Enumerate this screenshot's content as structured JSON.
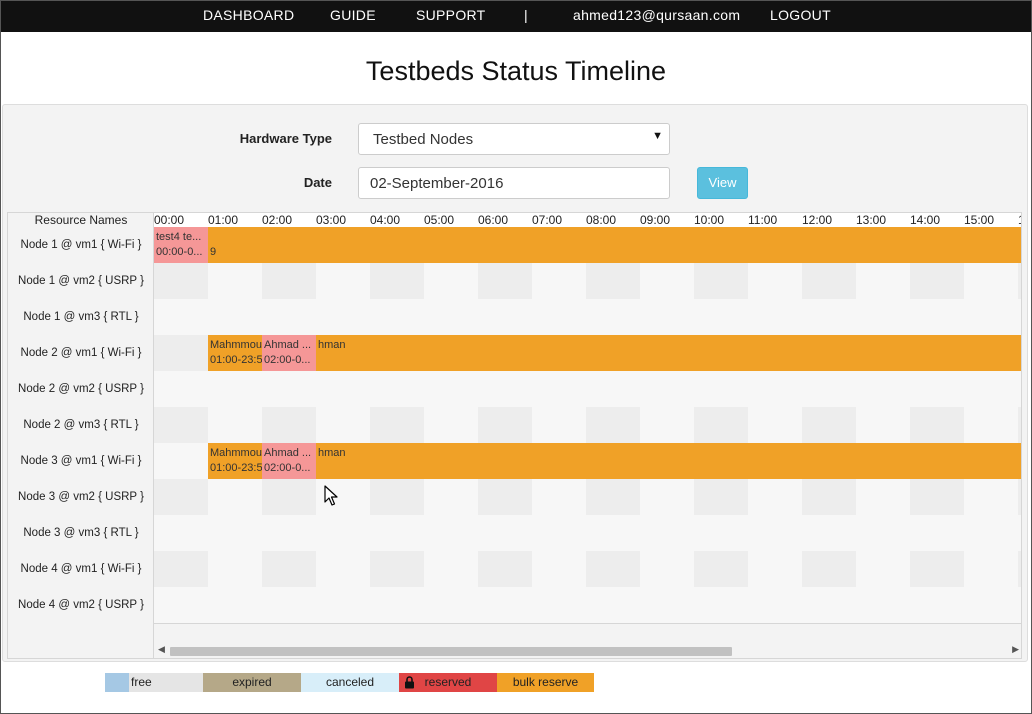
{
  "nav": {
    "dashboard": "DASHBOARD",
    "guide": "GUIDE",
    "support": "SUPPORT",
    "separator": "|",
    "user_email": "ahmed123@qursaan.com",
    "logout": "LOGOUT"
  },
  "page_title": "Testbeds Status Timeline",
  "form": {
    "hardware_label": "Hardware Type",
    "hardware_value": "Testbed Nodes",
    "date_label": "Date",
    "date_value": "02-September-2016",
    "view_button": "View"
  },
  "scheduler": {
    "resource_header": "Resource Names",
    "time_slots": [
      "00:00",
      "01:00",
      "02:00",
      "03:00",
      "04:00",
      "05:00",
      "06:00",
      "07:00",
      "08:00",
      "09:00",
      "10:00",
      "11:00",
      "12:00",
      "13:00",
      "14:00",
      "15:00",
      "1"
    ],
    "resources": [
      "Node 1 @ vm1 { Wi-Fi }",
      "Node 1 @ vm2 { USRP }",
      "Node 1 @ vm3 { RTL }",
      "Node 2 @ vm1 { Wi-Fi }",
      "Node 2 @ vm2 { USRP }",
      "Node 2 @ vm3 { RTL }",
      "Node 3 @ vm1 { Wi-Fi }",
      "Node 3 @ vm2 { USRP }",
      "Node 3 @ vm3 { RTL }",
      "Node 4 @ vm1 { Wi-Fi }",
      "Node 4 @ vm2 { USRP }"
    ],
    "events": {
      "n1_reserved_title": "test4 te...",
      "n1_reserved_time": "00:00-0...",
      "n1_bulk_time": "9",
      "n2_bulk_a_title": "Mahmmou",
      "n2_bulk_a_time": "01:00-23:5",
      "n2_res_title": "Ahmad ...",
      "n2_res_time": "02:00-0...",
      "n2_bulk_b_title": "hman",
      "n3_bulk_a_title": "Mahmmou",
      "n3_bulk_a_time": "01:00-23:5",
      "n3_res_title": "Ahmad ...",
      "n3_res_time": "02:00-0...",
      "n3_bulk_b_title": "hman"
    }
  },
  "legend": {
    "free": "free",
    "expired": "expired",
    "canceled": "canceled",
    "reserved": "reserved",
    "bulk_reserve": "bulk reserve"
  },
  "colors": {
    "free": "#a5c8e4",
    "free_bg": "#e5e5e5",
    "expired": "#b5a888",
    "canceled": "#d8eef9",
    "reserved": "#e04545",
    "bulk_reserve": "#f0a127",
    "reserved_event": "#f59797",
    "view_button": "#5bc0de"
  },
  "icons": {
    "reserved_legend": "lock-icon",
    "mouse_cursor": "arrow-cursor-icon"
  }
}
